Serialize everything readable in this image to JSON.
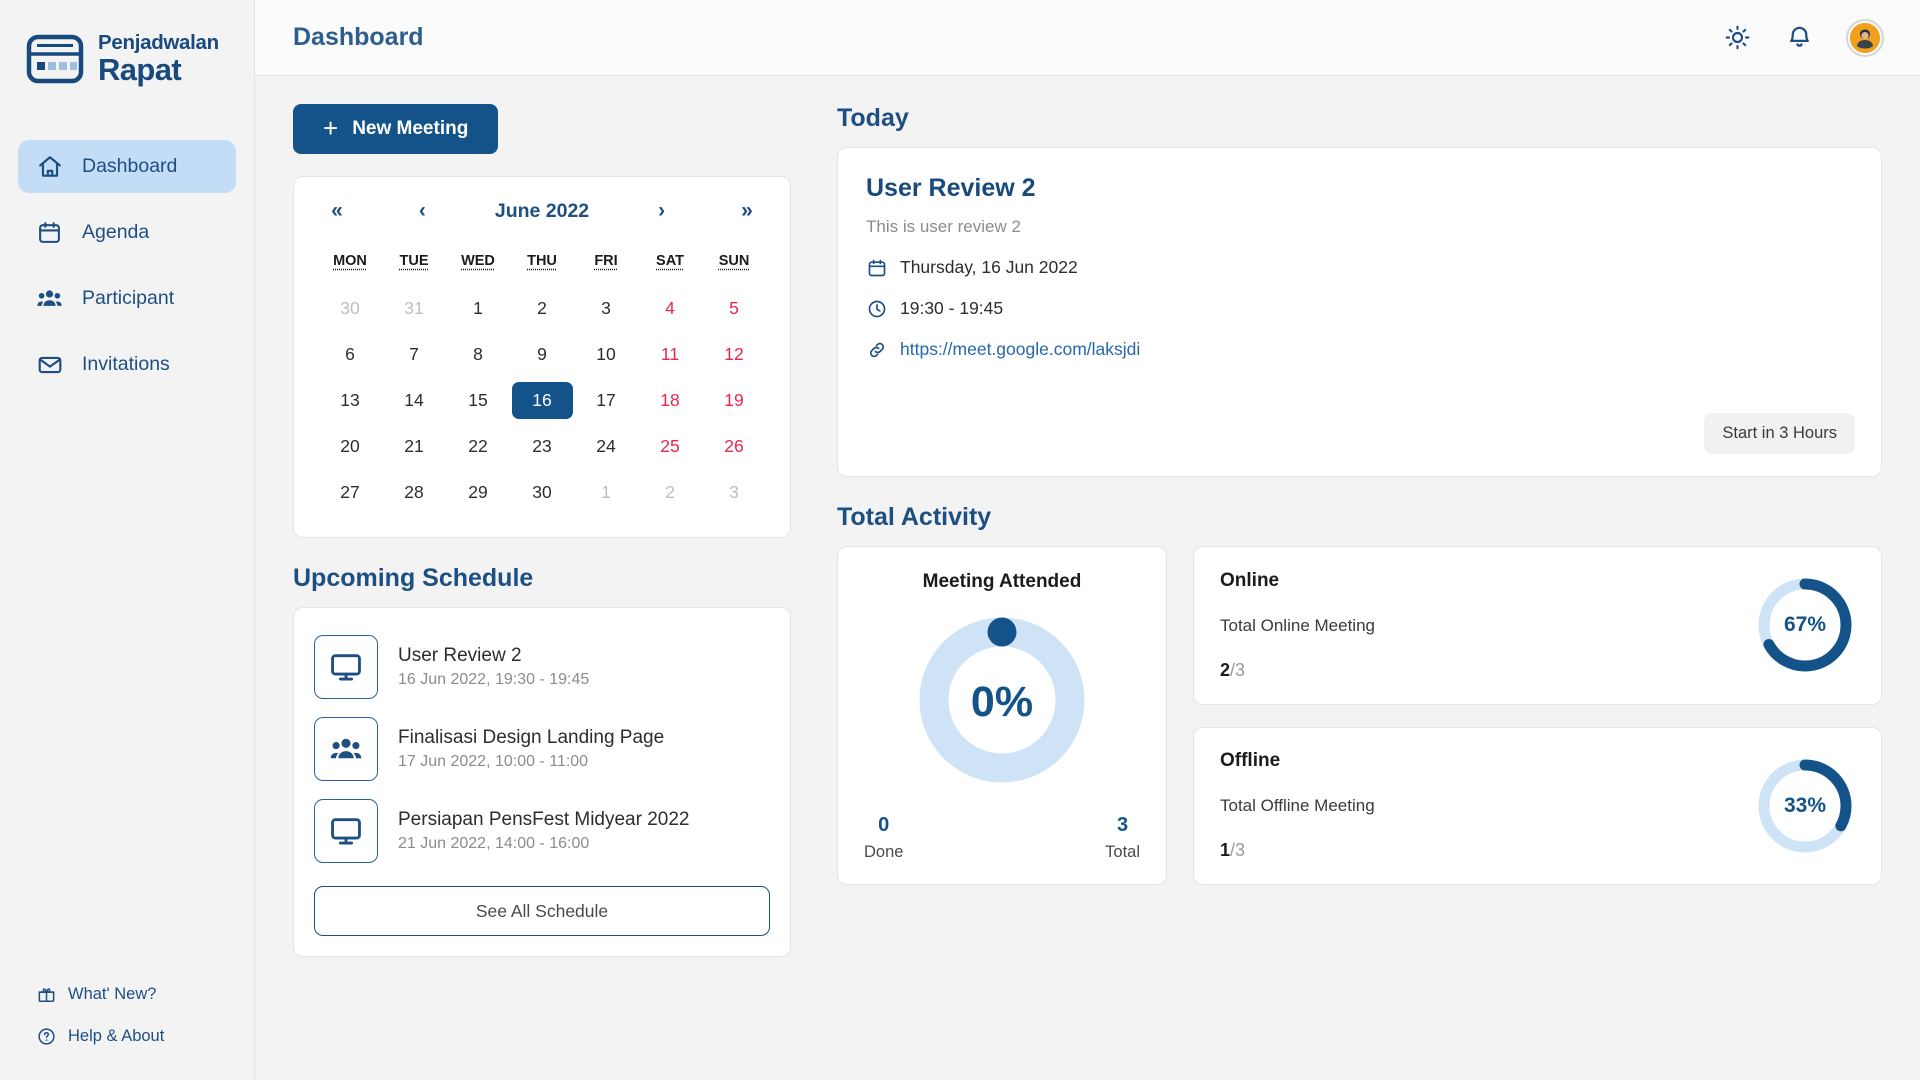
{
  "brand": {
    "line1": "Penjadwalan",
    "line2": "Rapat",
    "icon": "calendar-window-logo",
    "color": "#184a7e"
  },
  "sidebar": {
    "items": [
      {
        "label": "Dashboard",
        "icon": "home-icon",
        "active": true
      },
      {
        "label": "Agenda",
        "icon": "calendar-icon",
        "active": false
      },
      {
        "label": "Participant",
        "icon": "people-icon",
        "active": false
      },
      {
        "label": "Invitations",
        "icon": "envelope-icon",
        "active": false
      }
    ],
    "bottom_items": [
      {
        "label": "What' New?",
        "icon": "gift-icon"
      },
      {
        "label": "Help & About",
        "icon": "question-circle-icon"
      }
    ],
    "active_bg": "#c3ddf7"
  },
  "topbar": {
    "title": "Dashboard",
    "theme_icon": "sun-icon",
    "notification_icon": "bell-icon",
    "avatar_icon": "user-avatar",
    "avatar_bg": "#f0a01e"
  },
  "new_meeting_button": {
    "label": "New Meeting",
    "icon": "plus-icon"
  },
  "calendar": {
    "title": "June 2022",
    "nav": {
      "first": "«",
      "prev": "‹",
      "next": "›",
      "last": "»"
    },
    "dow": [
      "MON",
      "TUE",
      "WED",
      "THU",
      "FRI",
      "SAT",
      "SUN"
    ],
    "weeks": [
      [
        {
          "d": "30",
          "t": "muted"
        },
        {
          "d": "31",
          "t": "muted"
        },
        {
          "d": "1",
          "t": ""
        },
        {
          "d": "2",
          "t": ""
        },
        {
          "d": "3",
          "t": ""
        },
        {
          "d": "4",
          "t": "weekend"
        },
        {
          "d": "5",
          "t": "weekend"
        }
      ],
      [
        {
          "d": "6",
          "t": ""
        },
        {
          "d": "7",
          "t": ""
        },
        {
          "d": "8",
          "t": ""
        },
        {
          "d": "9",
          "t": ""
        },
        {
          "d": "10",
          "t": ""
        },
        {
          "d": "11",
          "t": "weekend"
        },
        {
          "d": "12",
          "t": "weekend"
        }
      ],
      [
        {
          "d": "13",
          "t": ""
        },
        {
          "d": "14",
          "t": ""
        },
        {
          "d": "15",
          "t": ""
        },
        {
          "d": "16",
          "t": "sel"
        },
        {
          "d": "17",
          "t": ""
        },
        {
          "d": "18",
          "t": "weekend"
        },
        {
          "d": "19",
          "t": "weekend"
        }
      ],
      [
        {
          "d": "20",
          "t": ""
        },
        {
          "d": "21",
          "t": ""
        },
        {
          "d": "22",
          "t": ""
        },
        {
          "d": "23",
          "t": ""
        },
        {
          "d": "24",
          "t": ""
        },
        {
          "d": "25",
          "t": "weekend"
        },
        {
          "d": "26",
          "t": "weekend"
        }
      ],
      [
        {
          "d": "27",
          "t": ""
        },
        {
          "d": "28",
          "t": ""
        },
        {
          "d": "29",
          "t": ""
        },
        {
          "d": "30",
          "t": ""
        },
        {
          "d": "1",
          "t": "muted"
        },
        {
          "d": "2",
          "t": "muted"
        },
        {
          "d": "3",
          "t": "muted"
        }
      ]
    ],
    "selected_day": "16",
    "selected_bg": "#14538a"
  },
  "today": {
    "heading": "Today",
    "meeting_title": "User Review 2",
    "description": "This is user review 2",
    "date": "Thursday, 16 Jun 2022",
    "time": "19:30 - 19:45",
    "link": "https://meet.google.com/laksjdi",
    "badge": "Start in 3 Hours",
    "date_icon": "calendar-icon",
    "time_icon": "clock-icon",
    "link_icon": "link-icon"
  },
  "upcoming": {
    "heading": "Upcoming Schedule",
    "items": [
      {
        "name": "User Review 2",
        "time": "16 Jun 2022, 19:30 - 19:45",
        "icon": "monitor-icon"
      },
      {
        "name": "Finalisasi Design Landing Page",
        "time": "17 Jun 2022, 10:00 - 11:00",
        "icon": "people-icon"
      },
      {
        "name": "Persiapan PensFest Midyear 2022",
        "time": "21 Jun 2022, 14:00 - 16:00",
        "icon": "monitor-icon"
      }
    ],
    "see_all_label": "See All Schedule"
  },
  "activity": {
    "heading": "Total Activity",
    "stats": [
      {
        "name": "Online",
        "sub": "Total Online Meeting",
        "value": "2",
        "total": "/3"
      },
      {
        "name": "Offline",
        "sub": "Total Offline Meeting",
        "value": "1",
        "total": "/3"
      }
    ]
  },
  "chart_data": [
    {
      "type": "pie",
      "title": "Meeting Attended",
      "percent_label": "0%",
      "percent": 0,
      "track_color": "#cfe3f7",
      "fill_color": "#14538a",
      "legend": [
        {
          "label": "Done",
          "value": 0
        },
        {
          "label": "Total",
          "value": 3
        }
      ]
    },
    {
      "type": "pie",
      "title": "Online",
      "percent_label": "67%",
      "percent": 67,
      "track_color": "#cfe3f7",
      "fill_color": "#14538a",
      "value": 2,
      "total": 3
    },
    {
      "type": "pie",
      "title": "Offline",
      "percent_label": "33%",
      "percent": 33,
      "track_color": "#cfe3f7",
      "fill_color": "#14538a",
      "value": 1,
      "total": 3
    }
  ]
}
